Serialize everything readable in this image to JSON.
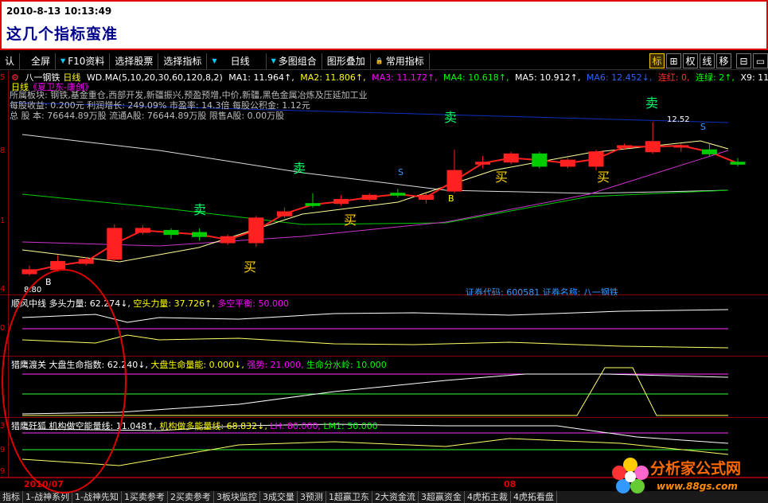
{
  "post": {
    "datetime": "2010-8-13 10:13:49",
    "title": "这几个指标蛮准"
  },
  "toolbar": {
    "items": [
      "认",
      "全屏",
      "F10资料",
      "选择股票",
      "选择指标",
      "日线",
      "多图组合",
      "图形叠加",
      "常用指标"
    ],
    "icons": [
      {
        "label": "标",
        "name": "mark-icon",
        "active": true
      },
      {
        "label": "⊞",
        "name": "crosshair-icon",
        "active": false
      },
      {
        "label": "权",
        "name": "rights-icon",
        "active": false
      },
      {
        "label": "线",
        "name": "line-icon",
        "active": false
      },
      {
        "label": "移",
        "name": "move-icon",
        "active": false
      },
      {
        "label": "⊟",
        "name": "window-icon",
        "active": false
      },
      {
        "label": "▭",
        "name": "restore-icon",
        "active": false
      }
    ]
  },
  "main": {
    "stock_name": "八一钢铁",
    "period": "日线",
    "ma_params": "WD.MA(5,10,20,30,60,120,8,2)",
    "ma1": "MA1: 11.964↑,",
    "ma2": "MA2: 11.806↑,",
    "ma3": "MA3: 11.172↑,",
    "ma4": "MA4: 10.618↑,",
    "ma5": "MA5: 10.912↑,",
    "ma6": "MA6: 12.452↓,",
    "lianhong": "连红: 0,",
    "lianlv": "连绿: 2↑,",
    "x9": "X9: 11.793↓",
    "subtitle_period": "日线",
    "subtitle_link": "《夏卫东-康创》",
    "sector": "所属板块: 钢铁,基金重仓,西部开发,新疆振兴,预盈预增,中价,新疆,黑色金属冶炼及压延加工业",
    "eps_row": "每股收益: 0.200元    利润增长: 249.09%    市盈率: 14.3倍   每股公积金: 1.12元",
    "shares_row": "总 股 本: 76644.89万股   流通A股: 76644.89万股   限售A股: 0.00万股",
    "high_label": "12.52",
    "low_label": "8.80",
    "stock_code_label": "证券代码: 600581  证券名称: 八一钢铁",
    "signals": [
      "卖",
      "卖",
      "卖",
      "卖",
      "买",
      "买",
      "买",
      "买",
      "S",
      "S",
      "B",
      "B"
    ]
  },
  "ind1": {
    "name": "顺风中线",
    "long_force": "多头力量: 62.274↓,",
    "short_force": "空头力量: 37.726↑,",
    "balance": "多空平衡: 50.000"
  },
  "ind2": {
    "name": "猎鹰渡关",
    "life_index": "大盘生命指数: 62.240↓,",
    "life_energy": "大盘生命量能: 0.000↓,",
    "strong": "强势: 21.000,",
    "watershed": "生命分水岭: 10.000"
  },
  "ind3": {
    "name": "猎鹰歼狐",
    "short_energy": "机构做空能量线: 11.048↑,",
    "long_energy": "机构做多能量线: 68.832↓,",
    "lh": "LH: 80.000,",
    "lm1": "LM1: 50.000"
  },
  "bottom": {
    "date_left": "2010/07",
    "date_mid": "08",
    "tabs": [
      "指标",
      "1-战神系列",
      "1-战神先知",
      "1买卖参考",
      "2买卖参考",
      "3板块监控",
      "3成交量",
      "3预测",
      "1超赢卫东",
      "2大资金流",
      "3超赢资金",
      "4虎拓主裁",
      "4虎拓看盘"
    ]
  },
  "watermark": {
    "name": "分析家公式网",
    "url": "www.88gs.com"
  },
  "chart_data": {
    "type": "candlestick",
    "title": "八一钢铁 日线",
    "note": "price approximated from pixel scale",
    "candles": [
      {
        "o": 8.85,
        "c": 8.95,
        "h": 9.05,
        "l": 8.8
      },
      {
        "o": 8.95,
        "c": 9.15,
        "h": 9.3,
        "l": 8.9
      },
      {
        "o": 9.1,
        "c": 9.2,
        "h": 9.25,
        "l": 9.05
      },
      {
        "o": 9.2,
        "c": 9.95,
        "h": 10.05,
        "l": 9.15
      },
      {
        "o": 9.85,
        "c": 9.95,
        "h": 10.02,
        "l": 9.8
      },
      {
        "o": 9.9,
        "c": 9.8,
        "h": 9.95,
        "l": 9.7
      },
      {
        "o": 9.85,
        "c": 9.75,
        "h": 9.95,
        "l": 9.65
      },
      {
        "o": 9.6,
        "c": 9.75,
        "h": 9.8,
        "l": 9.55
      },
      {
        "o": 9.6,
        "c": 10.2,
        "h": 10.25,
        "l": 9.5
      },
      {
        "o": 10.25,
        "c": 10.35,
        "h": 10.45,
        "l": 10.2
      },
      {
        "o": 10.55,
        "c": 10.5,
        "h": 10.8,
        "l": 10.45
      },
      {
        "o": 10.55,
        "c": 10.65,
        "h": 10.75,
        "l": 10.5
      },
      {
        "o": 10.65,
        "c": 10.75,
        "h": 10.8,
        "l": 10.6
      },
      {
        "o": 10.8,
        "c": 10.75,
        "h": 10.9,
        "l": 10.7
      },
      {
        "o": 10.65,
        "c": 10.75,
        "h": 10.8,
        "l": 10.55
      },
      {
        "o": 10.85,
        "c": 11.35,
        "h": 11.85,
        "l": 10.8
      },
      {
        "o": 11.5,
        "c": 11.55,
        "h": 11.7,
        "l": 11.4
      },
      {
        "o": 11.55,
        "c": 11.75,
        "h": 11.8,
        "l": 11.5
      },
      {
        "o": 11.75,
        "c": 11.45,
        "h": 11.8,
        "l": 11.4
      },
      {
        "o": 11.45,
        "c": 11.6,
        "h": 11.65,
        "l": 11.4
      },
      {
        "o": 11.45,
        "c": 11.8,
        "h": 11.85,
        "l": 11.35
      },
      {
        "o": 11.9,
        "c": 11.95,
        "h": 12.0,
        "l": 11.85
      },
      {
        "o": 11.8,
        "c": 12.05,
        "h": 12.52,
        "l": 11.75
      },
      {
        "o": 11.95,
        "c": 11.95,
        "h": 12.0,
        "l": 11.8
      },
      {
        "o": 11.85,
        "c": 11.75,
        "h": 12.0,
        "l": 11.7
      },
      {
        "o": 11.55,
        "c": 11.5,
        "h": 11.65,
        "l": 11.45
      }
    ]
  }
}
